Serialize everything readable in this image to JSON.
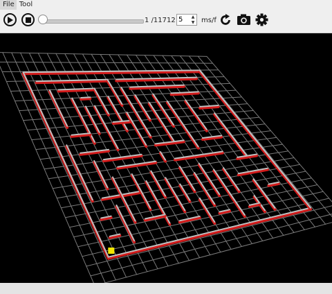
{
  "menu": {
    "file": "File",
    "tool": "Tool"
  },
  "playback": {
    "current_frame": "1",
    "frame_separator": "/11712",
    "speed_value": "5",
    "speed_unit": "ms/f",
    "progress_fraction": 0.0
  },
  "icons": {
    "play": "play-icon",
    "stop": "stop-icon",
    "reload": "refresh-icon",
    "screenshot": "camera-icon",
    "settings": "gear-icon"
  },
  "colors": {
    "wall_outline": "#d21b1b",
    "wall_top": "#bfbfbf",
    "grid": "#7a7a7a",
    "agent": "#f2e600",
    "background": "#000000"
  }
}
